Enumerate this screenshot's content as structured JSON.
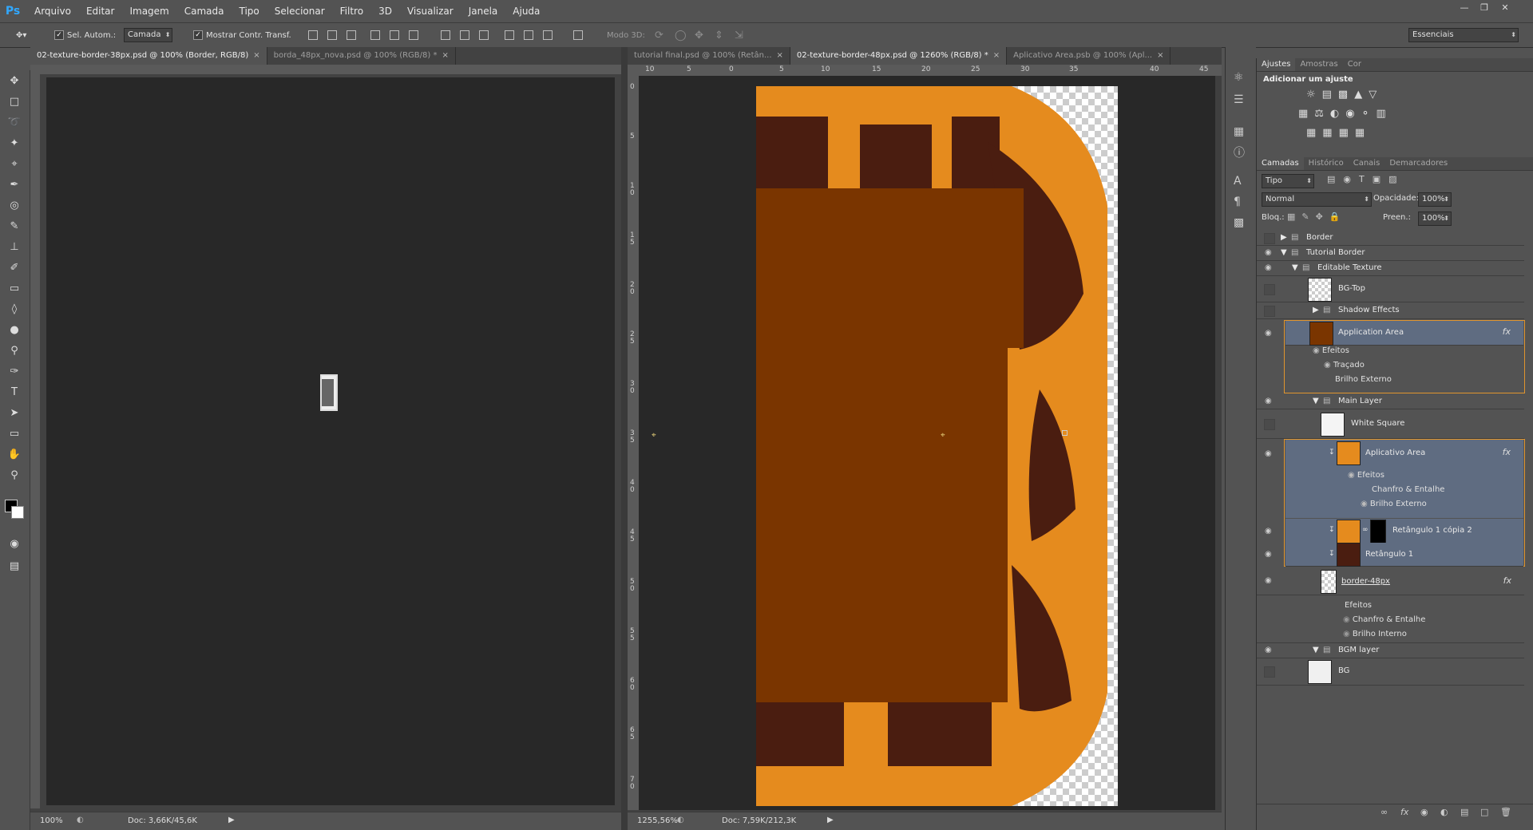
{
  "app": {
    "logo": "Ps"
  },
  "menu": [
    "Arquivo",
    "Editar",
    "Imagem",
    "Camada",
    "Tipo",
    "Selecionar",
    "Filtro",
    "3D",
    "Visualizar",
    "Janela",
    "Ajuda"
  ],
  "options": {
    "auto_select_label": "Sel. Autom.:",
    "auto_select_value": "Camada",
    "show_transform_label": "Mostrar Contr. Transf.",
    "mode3d_label": "Modo 3D:",
    "workspace": "Essenciais"
  },
  "left_doc": {
    "tabs": [
      {
        "label": "02-texture-border-38px.psd @ 100% (Border, RGB/8)",
        "active": true
      },
      {
        "label": "borda_48px_nova.psd @ 100% (RGB/8) *",
        "active": false
      }
    ],
    "zoom": "100%",
    "doc_info": "Doc: 3,66K/45,6K"
  },
  "right_doc": {
    "tabs": [
      {
        "label": "tutorial final.psd @ 100% (Retân...",
        "active": false
      },
      {
        "label": "02-texture-border-48px.psd @ 1260% (RGB/8) *",
        "active": true
      },
      {
        "label": "Aplicativo Area.psb @ 100% (Apl...",
        "active": false
      }
    ],
    "zoom": "1255,56%",
    "doc_info": "Doc: 7,59K/212,3K",
    "h_ruler": [
      "10",
      "5",
      "0",
      "5",
      "10",
      "15",
      "20",
      "25",
      "30",
      "35",
      "40",
      "45"
    ],
    "v_ruler": [
      "0",
      "5",
      "1\n0",
      "1\n5",
      "2\n0",
      "2\n5",
      "3\n0",
      "3\n5",
      "4\n0",
      "4\n5",
      "5\n0",
      "5\n5",
      "6\n0",
      "6\n5",
      "7\n0"
    ]
  },
  "panels": {
    "top_tabs": [
      "Ajustes",
      "Amostras",
      "Cor"
    ],
    "add_adjustment": "Adicionar um ajuste",
    "layer_tabs": [
      "Camadas",
      "Histórico",
      "Canais",
      "Demarcadores"
    ],
    "filter_kind": "Tipo",
    "blend_mode": "Normal",
    "opacity_label": "Opacidade:",
    "opacity_value": "100%",
    "lock_label": "Bloq.:",
    "fill_label": "Preen.:",
    "fill_value": "100%"
  },
  "layers": {
    "border": "Border",
    "tutorial_border": "Tutorial Border",
    "editable_texture": "Editable Texture",
    "bg_top": "BG-Top",
    "shadow_effects": "Shadow Effects",
    "application_area": "Application Area",
    "efeitos": "Efeitos",
    "tracado": "Traçado",
    "brilho_externo": "Brilho Externo",
    "main_layer": "Main Layer",
    "white_square": "White Square",
    "aplicativo_area": "Aplicativo Area",
    "chanfro": "Chanfro & Entalhe",
    "retangulo_copia": "Retângulo 1 cópia 2",
    "retangulo": "Retângulo 1",
    "border48": "border-48px",
    "brilho_interno": "Brilho Interno",
    "bgm_layer": "BGM layer",
    "bg": "BG",
    "fx": "fx"
  },
  "colors": {
    "orange": "#e58b1e",
    "brown": "#7a3500",
    "dark": "#4a1d10"
  }
}
